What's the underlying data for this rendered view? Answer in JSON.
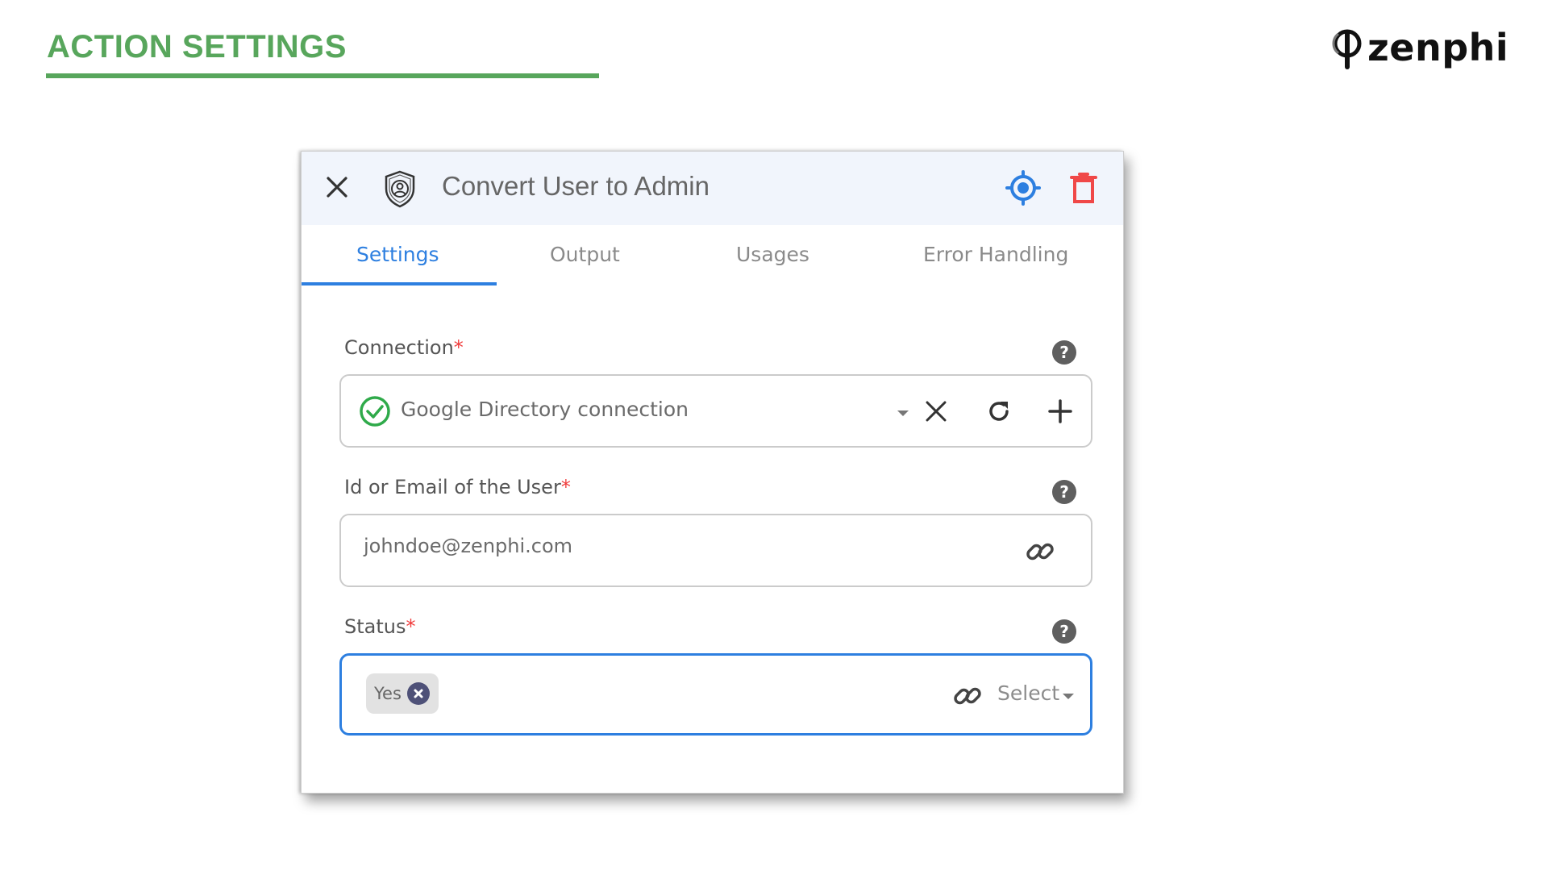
{
  "slide": {
    "title": "ACTION SETTINGS",
    "brand": "zenphi",
    "accent_color": "#58a65c"
  },
  "panel": {
    "title": "Convert User to Admin",
    "header_icons": {
      "close": "close-icon",
      "action": "shield-user-icon",
      "locate": "target-icon",
      "delete": "trash-icon"
    },
    "tabs": [
      {
        "label": "Settings",
        "active": true
      },
      {
        "label": "Output",
        "active": false
      },
      {
        "label": "Usages",
        "active": false
      },
      {
        "label": "Error Handling",
        "active": false
      }
    ],
    "fields": {
      "connection": {
        "label": "Connection",
        "required_mark": "*",
        "value": "Google Directory connection",
        "status": "connected"
      },
      "user": {
        "label": "Id or Email of the User",
        "required_mark": "*",
        "value": "johndoe@zenphi.com"
      },
      "status": {
        "label": "Status",
        "required_mark": "*",
        "selected": [
          "Yes"
        ],
        "placeholder": "Select"
      }
    }
  },
  "colors": {
    "primary": "#2d7fe0",
    "danger": "#f04848",
    "success": "#2faa4a",
    "required": "#f03c3c",
    "header_bg": "#f1f5fc"
  }
}
